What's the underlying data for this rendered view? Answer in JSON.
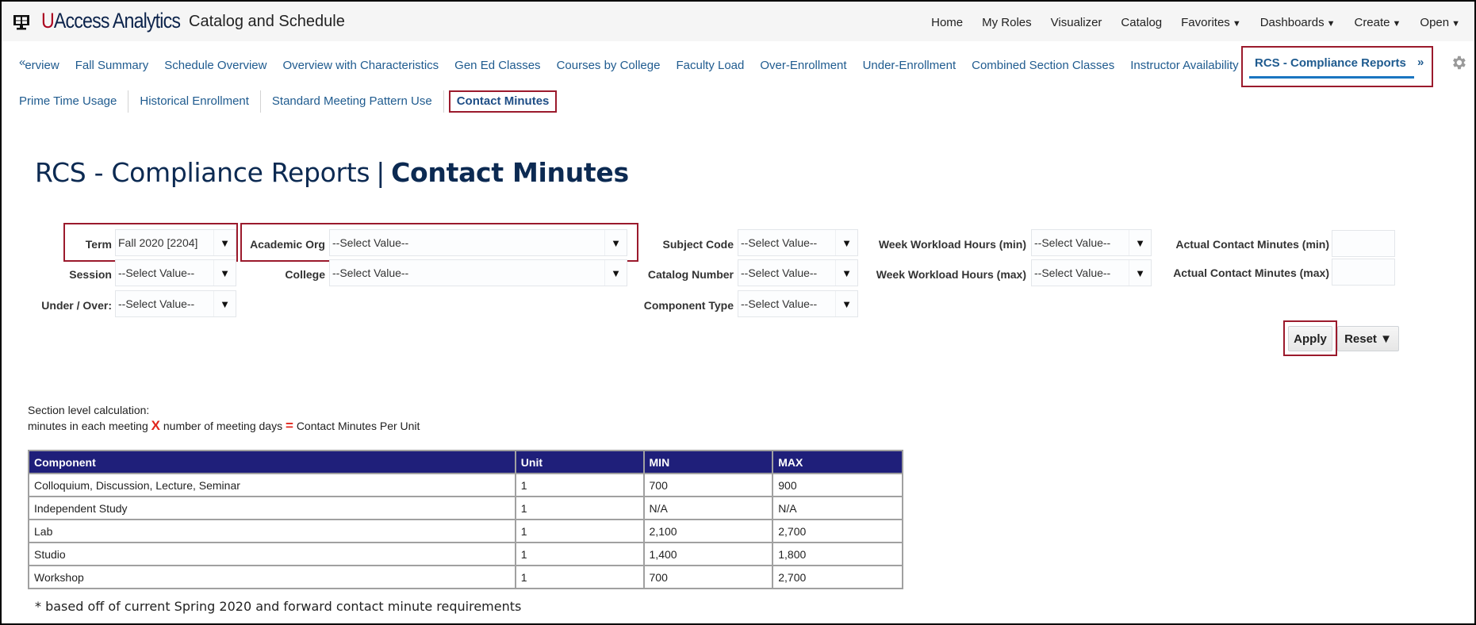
{
  "header": {
    "brand_u": "U",
    "brand_rest": "Access Analytics",
    "app_title": "Catalog and Schedule",
    "nav": [
      {
        "label": "Home",
        "dropdown": false
      },
      {
        "label": "My Roles",
        "dropdown": false
      },
      {
        "label": "Visualizer",
        "dropdown": false
      },
      {
        "label": "Catalog",
        "dropdown": false
      },
      {
        "label": "Favorites",
        "dropdown": true
      },
      {
        "label": "Dashboards",
        "dropdown": true
      },
      {
        "label": "Create",
        "dropdown": true
      },
      {
        "label": "Open",
        "dropdown": true
      }
    ],
    "caret": "▼"
  },
  "tabs": {
    "scroll_left": "«",
    "scroll_right": "»",
    "row1": [
      "erview",
      "Fall Summary",
      "Schedule Overview",
      "Overview with Characteristics",
      "Gen Ed Classes",
      "Courses by College",
      "Faculty Load",
      "Over-Enrollment",
      "Under-Enrollment",
      "Combined Section Classes",
      "Instructor Availability"
    ],
    "active": "RCS - Compliance Reports",
    "row2": [
      "Prime Time Usage",
      "Historical Enrollment",
      "Standard Meeting Pattern Use"
    ],
    "row2_current": "Contact Minutes"
  },
  "title": {
    "section": "RCS - Compliance Reports",
    "separator": "|",
    "page": "Contact Minutes"
  },
  "filters": {
    "term": {
      "label": "Term",
      "value": "Fall 2020 [2204]"
    },
    "session": {
      "label": "Session",
      "value": "--Select Value--"
    },
    "under_over": {
      "label": "Under / Over:",
      "value": "--Select Value--"
    },
    "academic_org": {
      "label": "Academic Org",
      "value": "--Select Value--"
    },
    "college": {
      "label": "College",
      "value": "--Select Value--"
    },
    "subject_code": {
      "label": "Subject Code",
      "value": "--Select Value--"
    },
    "catalog_number": {
      "label": "Catalog Number",
      "value": "--Select Value--"
    },
    "component_type": {
      "label": "Component Type",
      "value": "--Select Value--"
    },
    "workload_min": {
      "label": "Week Workload Hours (min)",
      "value": "--Select Value--"
    },
    "workload_max": {
      "label": "Week Workload Hours (max)",
      "value": "--Select Value--"
    },
    "contact_min": {
      "label": "Actual Contact Minutes (min)",
      "value": ""
    },
    "contact_max": {
      "label": "Actual Contact Minutes (max)",
      "value": ""
    },
    "arrow": "▼",
    "apply_label": "Apply",
    "reset_label": "Reset ▼"
  },
  "calculation": {
    "heading": "Section level calculation:",
    "part1": "minutes in each meeting",
    "times": "X",
    "part2": "number of meeting days",
    "equals": "=",
    "part3": "Contact Minutes Per Unit"
  },
  "table": {
    "headers": [
      "Component",
      "Unit",
      "MIN",
      "MAX"
    ],
    "rows": [
      [
        "Colloquium, Discussion, Lecture, Seminar",
        "1",
        "700",
        "900"
      ],
      [
        "Independent Study",
        "1",
        "N/A",
        "N/A"
      ],
      [
        "Lab",
        "1",
        "2,100",
        "2,700"
      ],
      [
        "Studio",
        "1",
        "1,400",
        "1,800"
      ],
      [
        "Workshop",
        "1",
        "700",
        "2,700"
      ]
    ]
  },
  "footnote": "* based off of current Spring 2020 and forward contact minute requirements",
  "colors": {
    "brand_red": "#ab0520",
    "brand_navy": "#0c234b",
    "link_blue": "#1f5b8f",
    "highlight_box": "#9b1a2c",
    "table_header": "#1f1f7a"
  }
}
